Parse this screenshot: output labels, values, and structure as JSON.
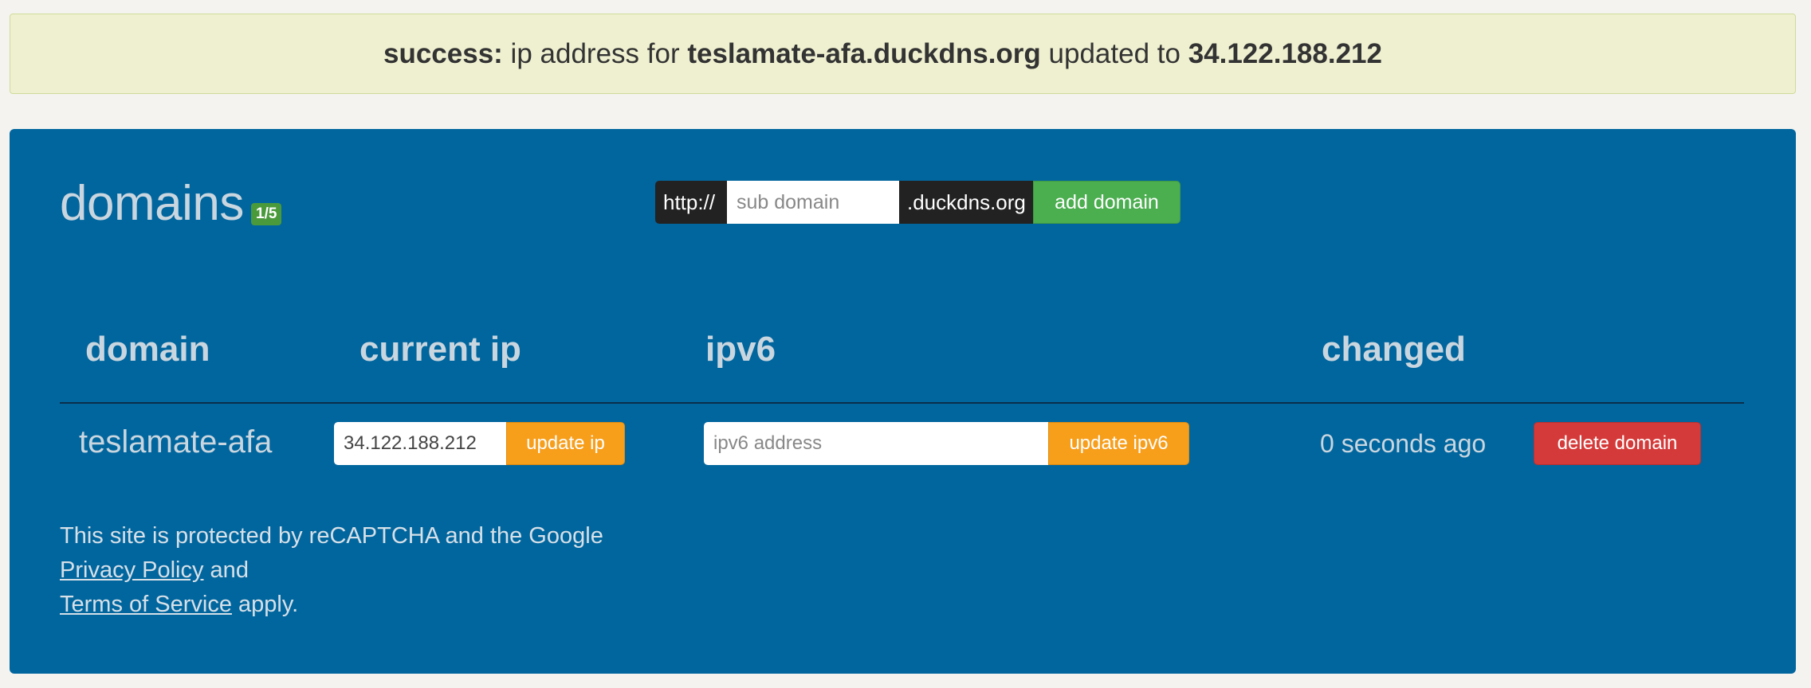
{
  "alert": {
    "label": "success:",
    "text_before": " ip address for ",
    "domain": "teslamate-afa.duckdns.org",
    "text_middle": " updated to ",
    "ip": "34.122.188.212"
  },
  "panel": {
    "title": "domains",
    "badge": "1/5",
    "add_form": {
      "prefix": "http://",
      "placeholder": "sub domain",
      "suffix": ".duckdns.org",
      "button": "add domain"
    },
    "table": {
      "headers": [
        "domain",
        "current ip",
        "ipv6",
        "changed"
      ],
      "rows": [
        {
          "domain": "teslamate-afa",
          "current_ip": "34.122.188.212",
          "update_ip_button": "update ip",
          "ipv6_placeholder": "ipv6 address",
          "update_ipv6_button": "update ipv6",
          "changed": "0 seconds ago",
          "delete_button": "delete domain"
        }
      ]
    },
    "recaptcha": {
      "line1": "This site is protected by reCAPTCHA and the Google",
      "privacy_link": "Privacy Policy",
      "and": " and",
      "terms_link": "Terms of Service",
      "apply": " apply."
    }
  },
  "colors": {
    "panel_bg": "#01669e",
    "alert_bg": "#eff0d0",
    "add_button": "#4bae4f",
    "update_button": "#f79e1b",
    "delete_button": "#d53a3a",
    "badge": "#4a9a3c"
  }
}
